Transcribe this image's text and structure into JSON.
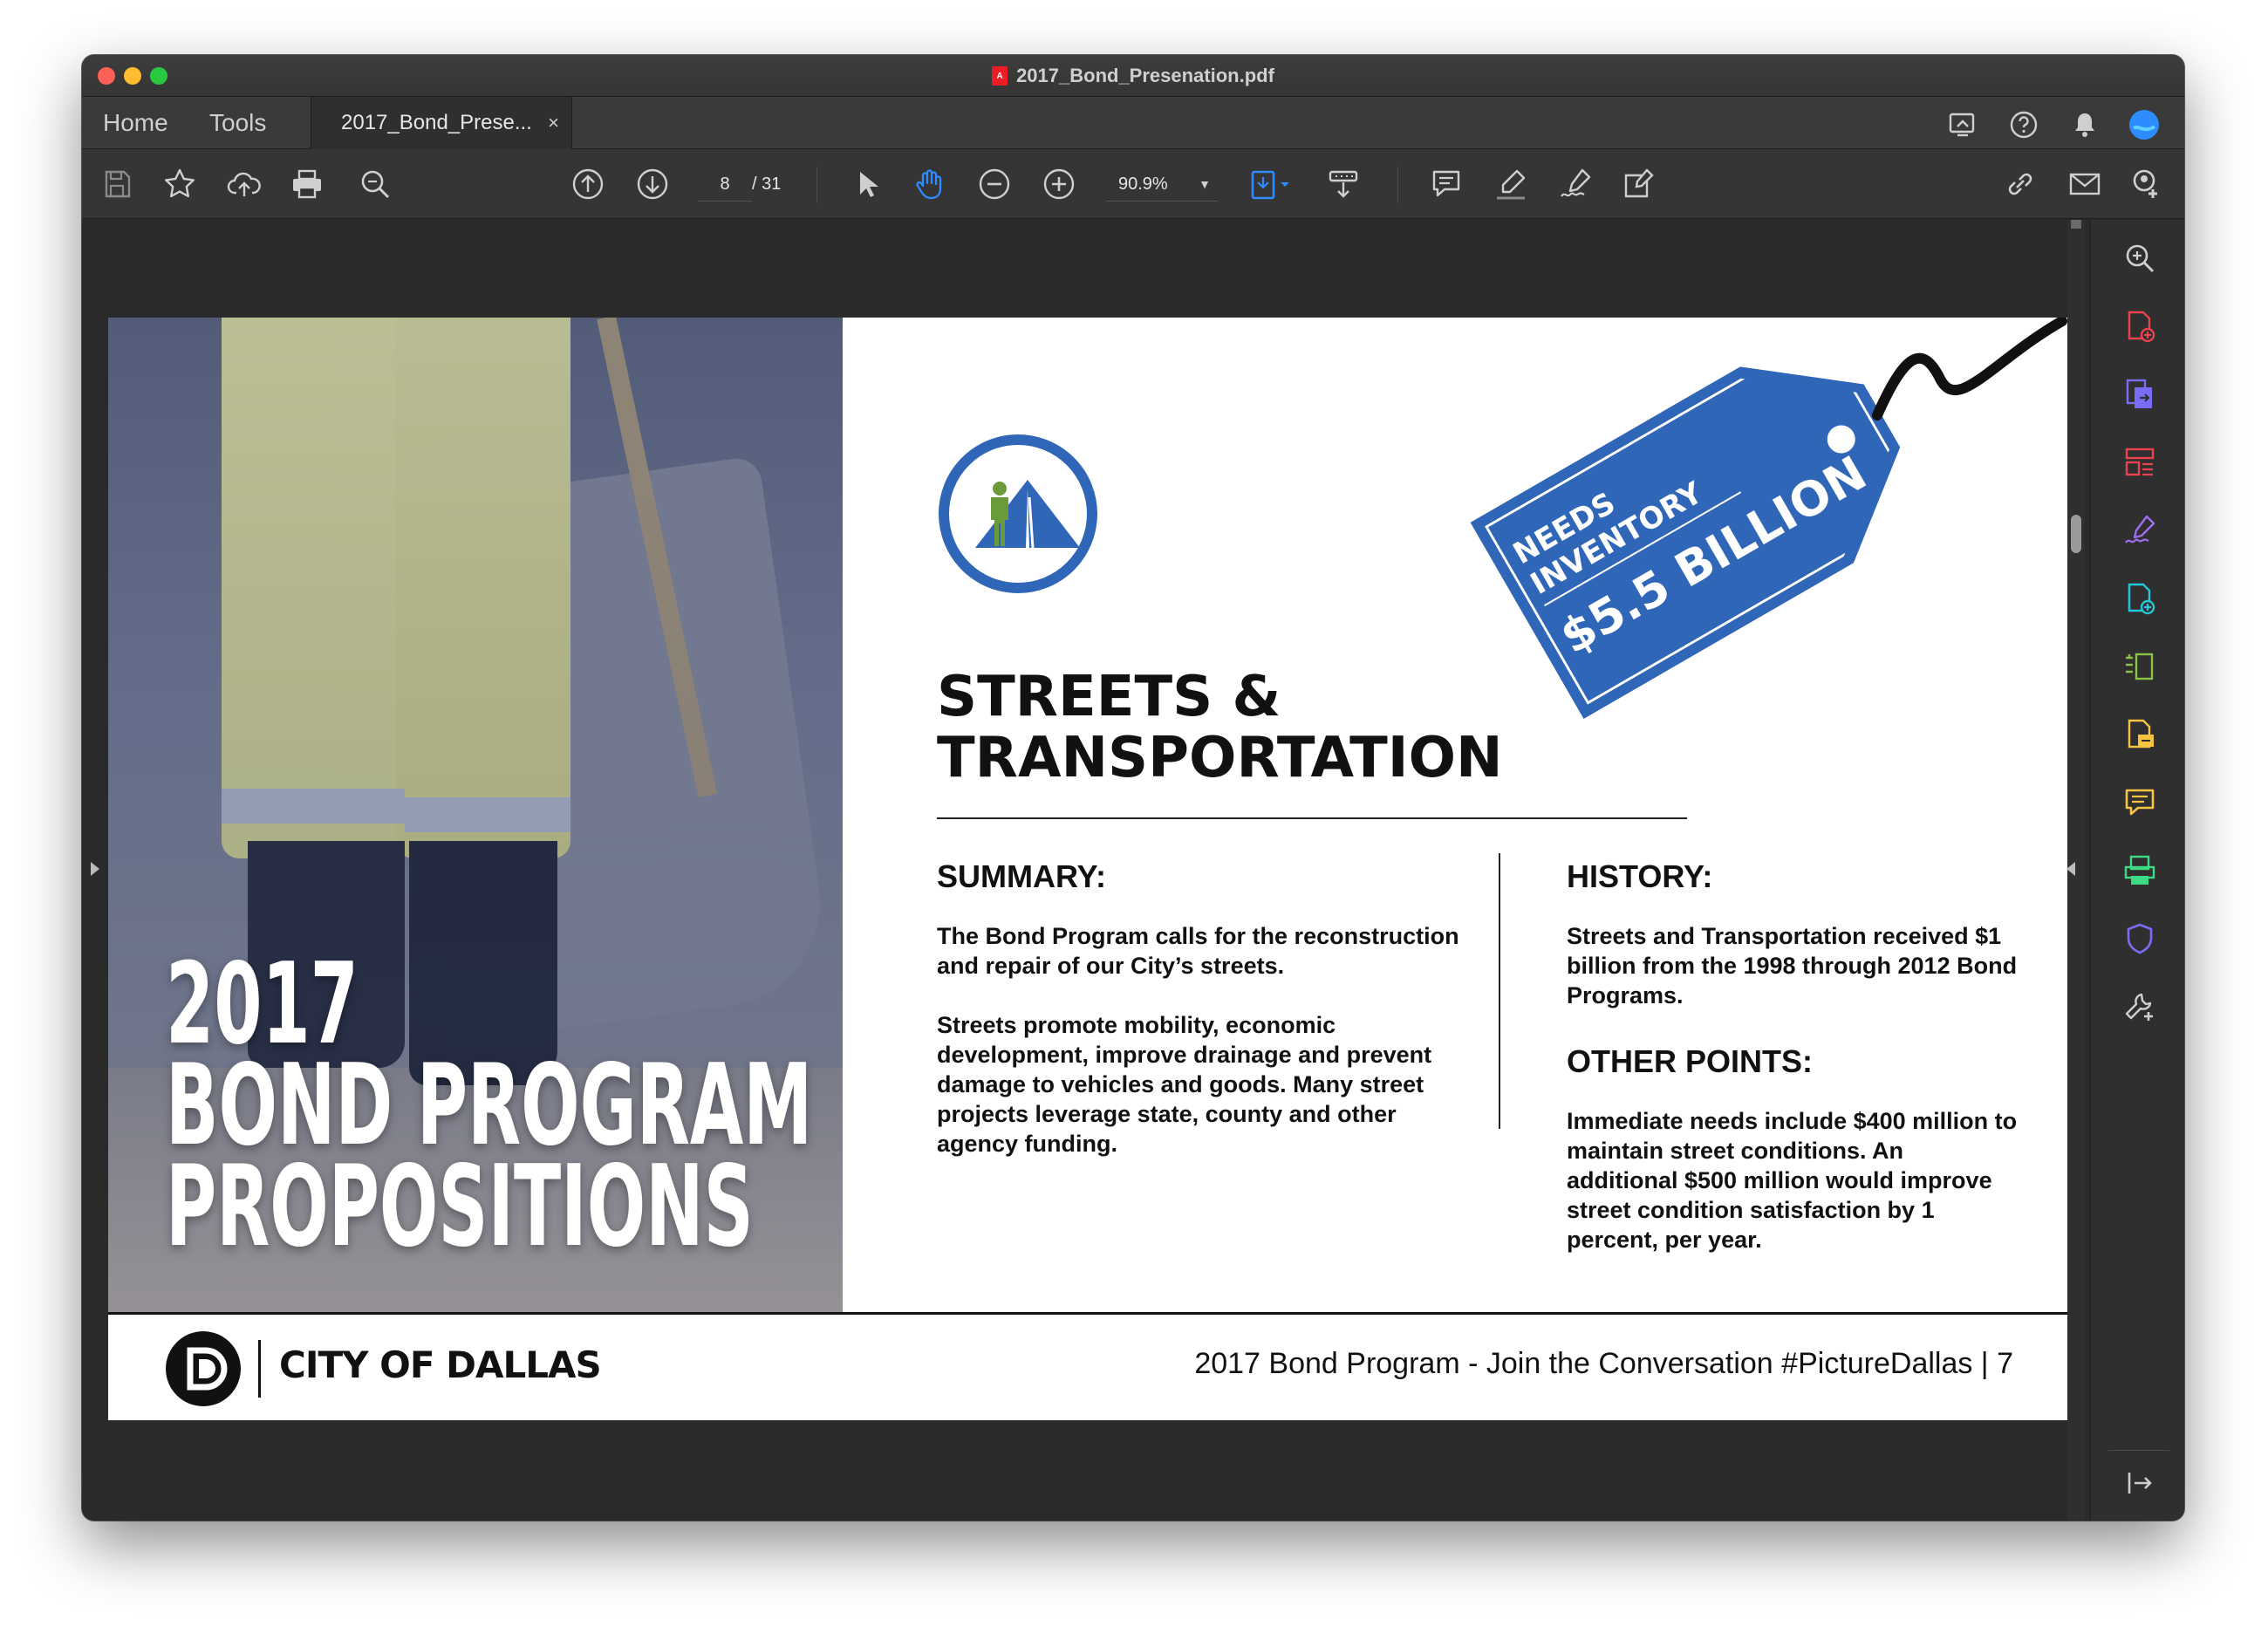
{
  "window": {
    "title": "2017_Bond_Presenation.pdf"
  },
  "tabs": {
    "home": "Home",
    "tools": "Tools",
    "document_tab": "2017_Bond_Prese...",
    "close": "×"
  },
  "toolbar": {
    "page_current": "8",
    "page_total": "/ 31",
    "zoom": "90.9%"
  },
  "page": {
    "cover_title": {
      "line1": "2017",
      "line2": "BOND PROGRAM",
      "line3": "PROPOSITIONS"
    },
    "heading": {
      "line1": "STREETS &",
      "line2": "TRANSPORTATION"
    },
    "price_tag": {
      "line1": "NEEDS",
      "line2": "INVENTORY",
      "amount": "$5.5 BILLION"
    },
    "summary": {
      "heading": "SUMMARY:",
      "para1": "The Bond Program calls for the reconstruction and repair of our City’s streets.",
      "para2": "Streets promote mobility, economic development, improve drainage and prevent damage to vehicles and goods. Many street projects leverage state, county and other agency funding."
    },
    "history": {
      "heading": "HISTORY:",
      "para": "Streets and Transportation received $1 billion from the 1998 through 2012 Bond Programs."
    },
    "other_points": {
      "heading": "OTHER POINTS:",
      "para": "Immediate needs include $400 million to maintain street conditions. An additional $500 million would improve street condition satisfaction by 1 percent, per year."
    },
    "footer": {
      "city": "CITY OF DALLAS",
      "tagline": "2017 Bond Program - Join the Conversation #PictureDallas | 7"
    }
  },
  "colors": {
    "brand_blue": "#2f66b8",
    "accent_blue": "#2d8cff"
  },
  "icons": {
    "toolbar": [
      "save-icon",
      "star-icon",
      "cloud-upload-icon",
      "print-icon",
      "search-icon",
      "prev-page-icon",
      "next-page-icon",
      "select-arrow-icon",
      "hand-icon",
      "zoom-out-icon",
      "zoom-in-icon",
      "fit-page-icon",
      "scroll-mode-icon",
      "comment-icon",
      "highlight-icon",
      "sign-icon",
      "fill-sign-icon",
      "share-link-icon",
      "email-icon",
      "add-user-icon"
    ],
    "sidebar": [
      "zoom-search-icon",
      "create-pdf-icon",
      "export-pdf-icon",
      "organize-pages-icon",
      "fill-sign-icon",
      "create-pdf-plus-icon",
      "edit-pdf-icon",
      "export-icon",
      "comment-icon",
      "scan-icon",
      "protect-icon",
      "tools-icon",
      "collapse-icon"
    ]
  }
}
